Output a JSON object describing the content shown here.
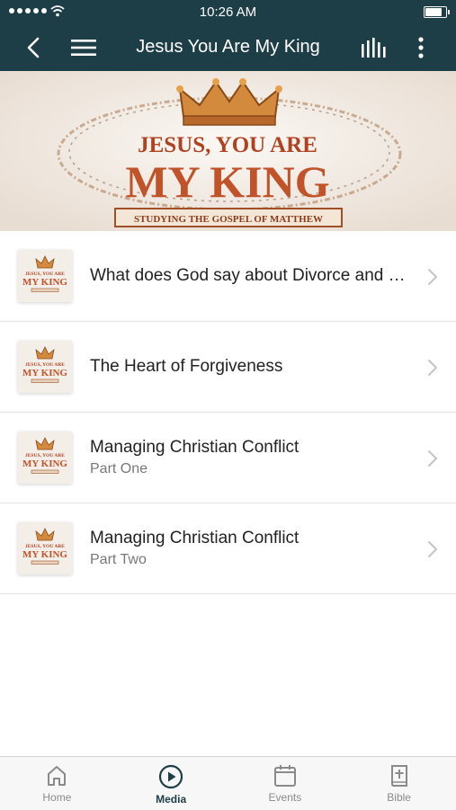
{
  "status_bar": {
    "time": "10:26 AM",
    "signal_icon": "signal-dots-icon",
    "wifi_icon": "wifi-icon",
    "battery_icon": "battery-icon",
    "battery_level": 0.9
  },
  "nav": {
    "title": "Jesus You Are My King",
    "back_icon": "back-chevron-icon",
    "menu_icon": "hamburger-menu-icon",
    "audio_icon": "audio-bars-icon",
    "more_icon": "more-vertical-icon"
  },
  "banner": {
    "line1": "JESUS, YOU ARE",
    "line2": "MY KING",
    "subtitle": "STUDYING THE GOSPEL OF MATTHEW"
  },
  "thumb": {
    "line1": "JESUS, YOU ARE",
    "line2": "MY KING"
  },
  "items": [
    {
      "title": "What does God say about Divorce and Remarriage?",
      "subtitle": ""
    },
    {
      "title": "The Heart of Forgiveness",
      "subtitle": ""
    },
    {
      "title": "Managing Christian Conflict",
      "subtitle": "Part One"
    },
    {
      "title": "Managing Christian Conflict",
      "subtitle": "Part Two"
    }
  ],
  "tabs": [
    {
      "label": "Home",
      "icon": "home-icon",
      "active": false
    },
    {
      "label": "Media",
      "icon": "play-circle-icon",
      "active": true
    },
    {
      "label": "Events",
      "icon": "calendar-icon",
      "active": false
    },
    {
      "label": "Bible",
      "icon": "bible-icon",
      "active": false
    }
  ],
  "colors": {
    "header": "#1d3d47",
    "accent": "#c0532a",
    "text": "#222222"
  }
}
